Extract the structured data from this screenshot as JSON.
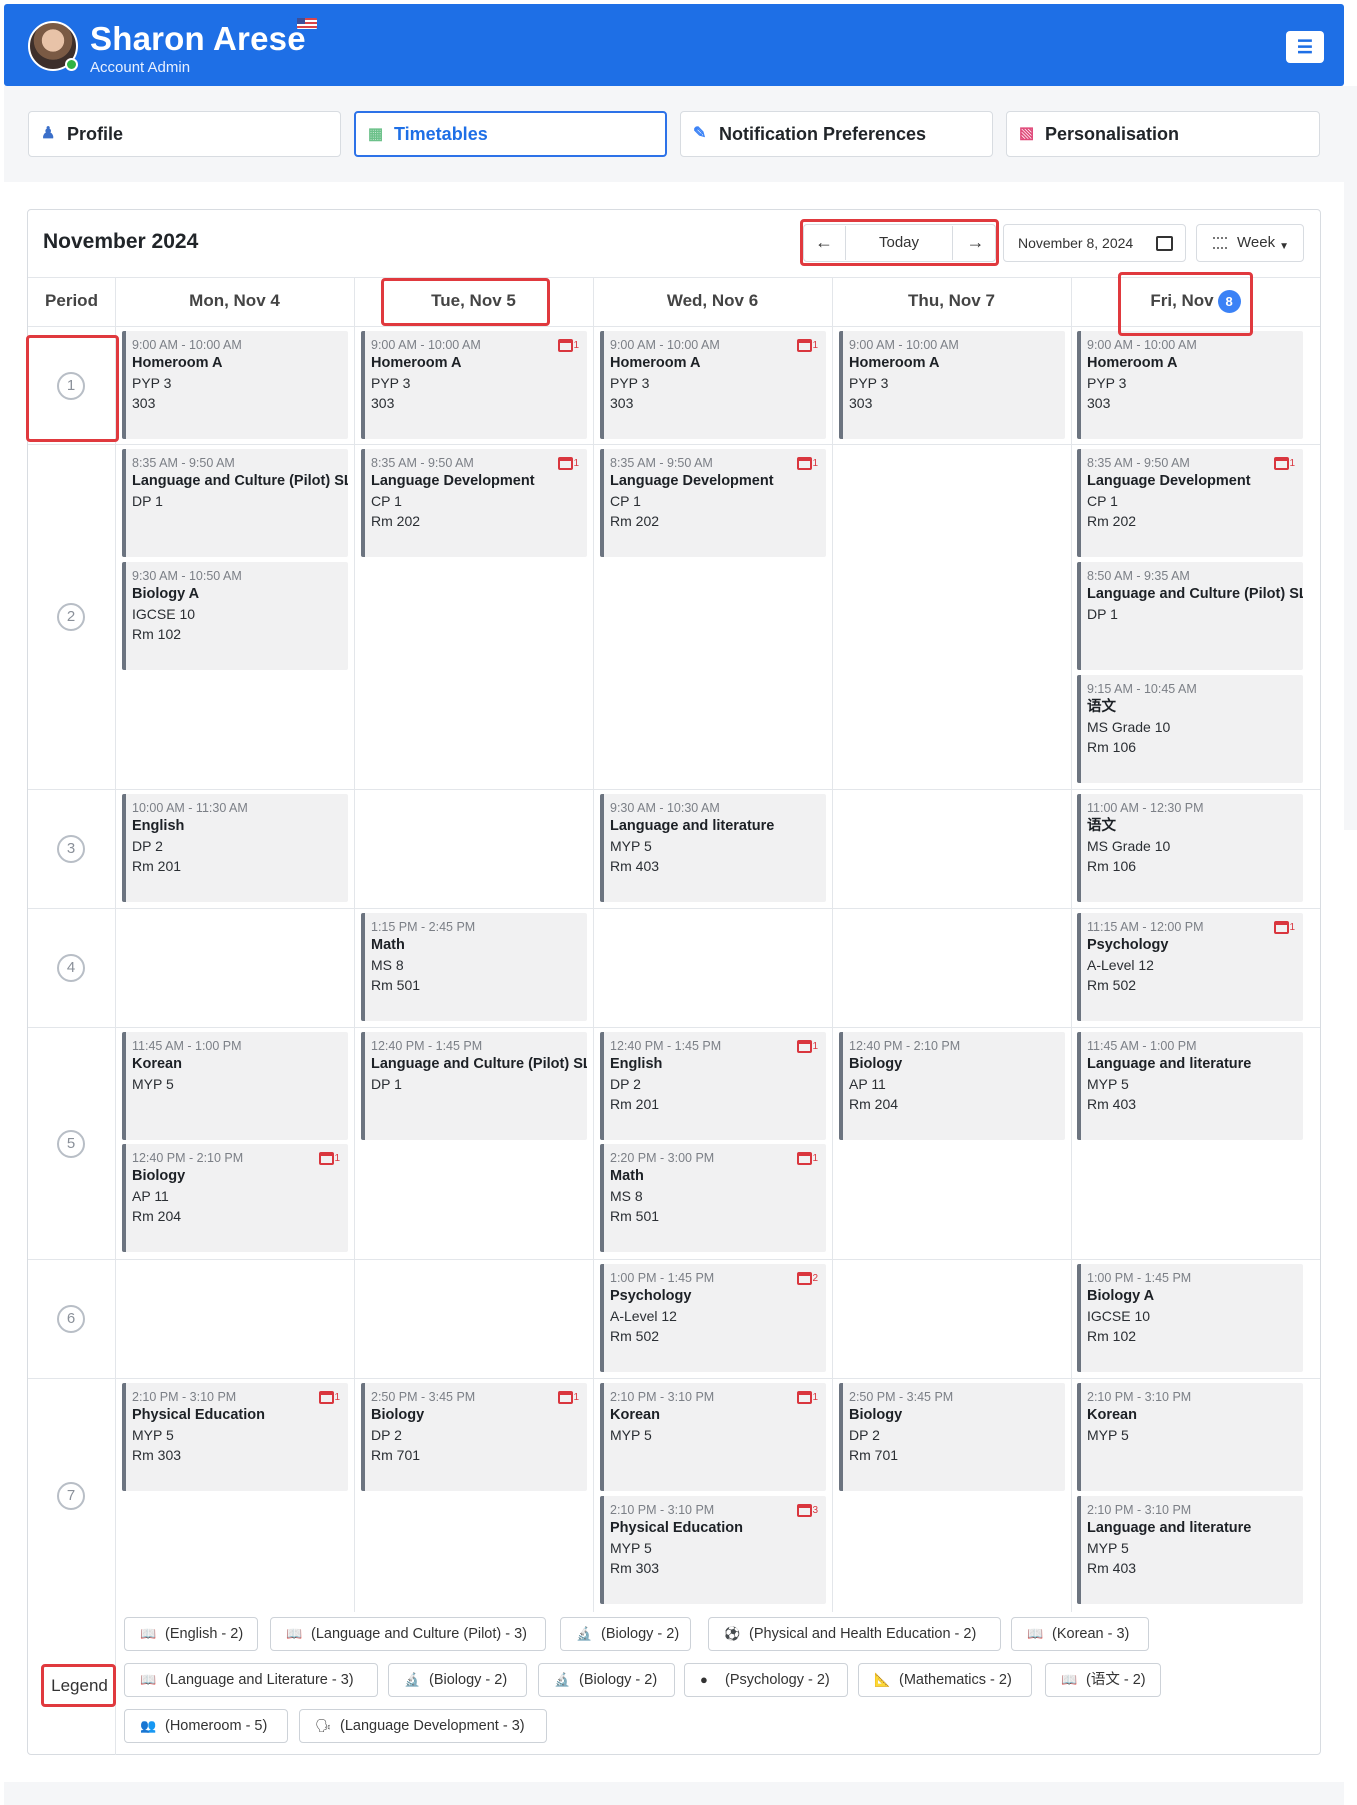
{
  "header": {
    "user_name": "Sharon Arese",
    "user_role": "Account Admin"
  },
  "tabs": [
    {
      "label": "Profile",
      "icon": "profile-icon"
    },
    {
      "label": "Timetables",
      "icon": "timetable-icon"
    },
    {
      "label": "Notification Preferences",
      "icon": "notification-icon"
    },
    {
      "label": "Personalisation",
      "icon": "personalisation-icon"
    }
  ],
  "calendar": {
    "month_title": "November 2024",
    "today_label": "Today",
    "date_value": "November 8, 2024",
    "view_label": "Week",
    "period_header": "Period",
    "days": [
      "Mon, Nov 4",
      "Tue, Nov 5",
      "Wed, Nov 6",
      "Thu, Nov 7",
      "Fri, Nov"
    ],
    "fri_badge": "8",
    "periods": [
      "1",
      "2",
      "3",
      "4",
      "5",
      "6",
      "7"
    ]
  },
  "events": [
    {
      "day": 0,
      "row": 0,
      "time": "9:00 AM - 10:00 AM",
      "name": "Homeroom A",
      "lines": [
        "PYP 3",
        "303"
      ],
      "count": ""
    },
    {
      "day": 1,
      "row": 0,
      "time": "9:00 AM - 10:00 AM",
      "name": "Homeroom A",
      "lines": [
        "PYP 3",
        "303"
      ],
      "count": "1"
    },
    {
      "day": 2,
      "row": 0,
      "time": "9:00 AM - 10:00 AM",
      "name": "Homeroom A",
      "lines": [
        "PYP 3",
        "303"
      ],
      "count": "1"
    },
    {
      "day": 3,
      "row": 0,
      "time": "9:00 AM - 10:00 AM",
      "name": "Homeroom A",
      "lines": [
        "PYP 3",
        "303"
      ],
      "count": ""
    },
    {
      "day": 4,
      "row": 0,
      "time": "9:00 AM - 10:00 AM",
      "name": "Homeroom A",
      "lines": [
        "PYP 3",
        "303"
      ],
      "count": ""
    },
    {
      "day": 0,
      "row": 1,
      "time": "8:35 AM - 9:50 AM",
      "name": "Language and Culture (Pilot) SL",
      "lines": [
        "DP 1"
      ],
      "count": ""
    },
    {
      "day": 0,
      "row": 2,
      "time": "9:30 AM - 10:50 AM",
      "name": "Biology A",
      "lines": [
        "IGCSE 10",
        "Rm 102"
      ],
      "count": ""
    },
    {
      "day": 1,
      "row": 1,
      "time": "8:35 AM - 9:50 AM",
      "name": "Language Development",
      "lines": [
        "CP 1",
        "Rm 202"
      ],
      "count": "1"
    },
    {
      "day": 2,
      "row": 1,
      "time": "8:35 AM - 9:50 AM",
      "name": "Language Development",
      "lines": [
        "CP 1",
        "Rm 202"
      ],
      "count": "1"
    },
    {
      "day": 4,
      "row": 1,
      "time": "8:35 AM - 9:50 AM",
      "name": "Language Development",
      "lines": [
        "CP 1",
        "Rm 202"
      ],
      "count": "1"
    },
    {
      "day": 4,
      "row": 2,
      "time": "8:50 AM - 9:35 AM",
      "name": "Language and Culture (Pilot) SL",
      "lines": [
        "DP 1"
      ],
      "count": ""
    },
    {
      "day": 4,
      "row": 3,
      "time": "9:15 AM - 10:45 AM",
      "name": "语文",
      "lines": [
        "MS Grade 10",
        "Rm 106"
      ],
      "count": ""
    },
    {
      "day": 0,
      "row": 4,
      "time": "10:00 AM - 11:30 AM",
      "name": "English",
      "lines": [
        "DP 2",
        "Rm 201"
      ],
      "count": ""
    },
    {
      "day": 2,
      "row": 4,
      "time": "9:30 AM - 10:30 AM",
      "name": "Language and literature",
      "lines": [
        "MYP 5",
        "Rm 403"
      ],
      "count": ""
    },
    {
      "day": 4,
      "row": 4,
      "time": "11:00 AM - 12:30 PM",
      "name": "语文",
      "lines": [
        "MS Grade 10",
        "Rm 106"
      ],
      "count": ""
    },
    {
      "day": 1,
      "row": 5,
      "time": "1:15 PM - 2:45 PM",
      "name": "Math",
      "lines": [
        "MS 8",
        "Rm 501"
      ],
      "count": ""
    },
    {
      "day": 4,
      "row": 5,
      "time": "11:15 AM - 12:00 PM",
      "name": "Psychology",
      "lines": [
        "A-Level 12",
        "Rm 502"
      ],
      "count": "1"
    },
    {
      "day": 0,
      "row": 6,
      "time": "11:45 AM - 1:00 PM",
      "name": "Korean",
      "lines": [
        "MYP 5"
      ],
      "count": ""
    },
    {
      "day": 0,
      "row": 7,
      "time": "12:40 PM - 2:10 PM",
      "name": "Biology",
      "lines": [
        "AP 11",
        "Rm 204"
      ],
      "count": "1"
    },
    {
      "day": 1,
      "row": 6,
      "time": "12:40 PM - 1:45 PM",
      "name": "Language and Culture (Pilot) SL",
      "lines": [
        "DP 1"
      ],
      "count": ""
    },
    {
      "day": 2,
      "row": 6,
      "time": "12:40 PM - 1:45 PM",
      "name": "English",
      "lines": [
        "DP 2",
        "Rm 201"
      ],
      "count": "1"
    },
    {
      "day": 2,
      "row": 7,
      "time": "2:20 PM - 3:00 PM",
      "name": "Math",
      "lines": [
        "MS 8",
        "Rm 501"
      ],
      "count": "1"
    },
    {
      "day": 3,
      "row": 6,
      "time": "12:40 PM - 2:10 PM",
      "name": "Biology",
      "lines": [
        "AP 11",
        "Rm 204"
      ],
      "count": ""
    },
    {
      "day": 4,
      "row": 6,
      "time": "11:45 AM - 1:00 PM",
      "name": "Language and literature",
      "lines": [
        "MYP 5",
        "Rm 403"
      ],
      "count": ""
    },
    {
      "day": 2,
      "row": 8,
      "time": "1:00 PM - 1:45 PM",
      "name": "Psychology",
      "lines": [
        "A-Level 12",
        "Rm 502"
      ],
      "count": "2"
    },
    {
      "day": 4,
      "row": 8,
      "time": "1:00 PM - 1:45 PM",
      "name": "Biology A",
      "lines": [
        "IGCSE 10",
        "Rm 102"
      ],
      "count": ""
    },
    {
      "day": 0,
      "row": 9,
      "time": "2:10 PM - 3:10 PM",
      "name": "Physical Education",
      "lines": [
        "MYP 5",
        "Rm 303"
      ],
      "count": "1"
    },
    {
      "day": 1,
      "row": 9,
      "time": "2:50 PM - 3:45 PM",
      "name": "Biology",
      "lines": [
        "DP 2",
        "Rm 701"
      ],
      "count": "1"
    },
    {
      "day": 2,
      "row": 9,
      "time": "2:10 PM - 3:10 PM",
      "name": "Korean",
      "lines": [
        "MYP 5"
      ],
      "count": "1"
    },
    {
      "day": 2,
      "row": 10,
      "time": "2:10 PM - 3:10 PM",
      "name": "Physical Education",
      "lines": [
        "MYP 5",
        "Rm 303"
      ],
      "count": "3"
    },
    {
      "day": 3,
      "row": 9,
      "time": "2:50 PM - 3:45 PM",
      "name": "Biology",
      "lines": [
        "DP 2",
        "Rm 701"
      ],
      "count": ""
    },
    {
      "day": 4,
      "row": 9,
      "time": "2:10 PM - 3:10 PM",
      "name": "Korean",
      "lines": [
        "MYP 5"
      ],
      "count": ""
    },
    {
      "day": 4,
      "row": 10,
      "time": "2:10 PM - 3:10 PM",
      "name": "Language and literature",
      "lines": [
        "MYP 5",
        "Rm 403"
      ],
      "count": ""
    }
  ],
  "legend": {
    "label": "Legend",
    "items": [
      {
        "text": "(English - 2)",
        "icon": "book-icon"
      },
      {
        "text": "(Language and Culture (Pilot) - 3)",
        "icon": "book-icon"
      },
      {
        "text": "(Biology - 2)",
        "icon": "microscope-icon"
      },
      {
        "text": "(Physical and Health Education - 2)",
        "icon": "ball-icon"
      },
      {
        "text": "(Korean - 3)",
        "icon": "book-icon"
      },
      {
        "text": "(Language and Literature - 3)",
        "icon": "book-icon"
      },
      {
        "text": "(Biology - 2)",
        "icon": "microscope-icon"
      },
      {
        "text": "(Biology - 2)",
        "icon": "microscope-icon"
      },
      {
        "text": "(Psychology - 2)",
        "icon": "brain-icon"
      },
      {
        "text": "(Mathematics - 2)",
        "icon": "ruler-icon"
      },
      {
        "text": "(语文 - 2)",
        "icon": "book-icon"
      },
      {
        "text": "(Homeroom - 5)",
        "icon": "people-icon"
      },
      {
        "text": "(Language Development - 3)",
        "icon": "language-icon"
      }
    ]
  }
}
